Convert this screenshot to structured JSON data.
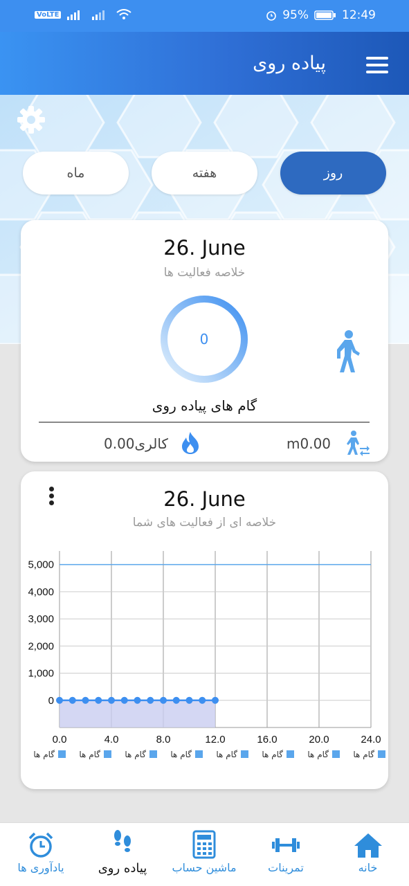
{
  "status_bar": {
    "network": "VoLTE 4G 3G",
    "battery": "95%",
    "time": "12:49"
  },
  "app_bar": {
    "title": "پیاده روی",
    "menu_icon": "hamburger-menu-icon"
  },
  "period_tabs": [
    {
      "label": "ماه",
      "active": false
    },
    {
      "label": "هفته",
      "active": false
    },
    {
      "label": "روز",
      "active": true
    }
  ],
  "summary_card": {
    "date": "26. June",
    "subtitle": "خلاصه فعالیت ها",
    "steps_value": "0",
    "steps_label": "گام های پیاده روی",
    "calories": "0.00کالری",
    "distance": "m0.00"
  },
  "chart_card": {
    "date": "26. June",
    "subtitle": "خلاصه ای از فعالیت های شما"
  },
  "colors": {
    "accent": "#3d8ff0",
    "active_tab": "#2e6ac0",
    "nav_icon": "#2f8ddb"
  },
  "chart_data": {
    "type": "area",
    "x": [
      0,
      1,
      2,
      3,
      4,
      5,
      6,
      7,
      8,
      9,
      10,
      11,
      12
    ],
    "series": [
      {
        "name": "گام ها",
        "values": [
          0,
          0,
          0,
          0,
          0,
          0,
          0,
          0,
          0,
          0,
          0,
          0,
          0
        ]
      }
    ],
    "goal_line": 5000,
    "xlim": [
      0,
      24
    ],
    "ylim": [
      -1000,
      5500
    ],
    "xticks": [
      "0.0",
      "4.0",
      "8.0",
      "12.0",
      "16.0",
      "20.0",
      "24.0"
    ],
    "yticks": [
      "0",
      "1,000",
      "2,000",
      "3,000",
      "4,000",
      "5,000"
    ],
    "ytick_values": [
      0,
      1000,
      2000,
      3000,
      4000,
      5000
    ],
    "legend_repeat": 8,
    "legend_label": "گام ها",
    "grid": true
  },
  "bottom_nav": [
    {
      "label": "یادآوری ها",
      "icon": "alarm-clock-icon",
      "active": false
    },
    {
      "label": "پیاده روی",
      "icon": "footsteps-icon",
      "active": true
    },
    {
      "label": "ماشین حساب",
      "icon": "calculator-icon",
      "active": false
    },
    {
      "label": "تمرینات",
      "icon": "dumbbell-icon",
      "active": false
    },
    {
      "label": "خانه",
      "icon": "home-icon",
      "active": false
    }
  ]
}
